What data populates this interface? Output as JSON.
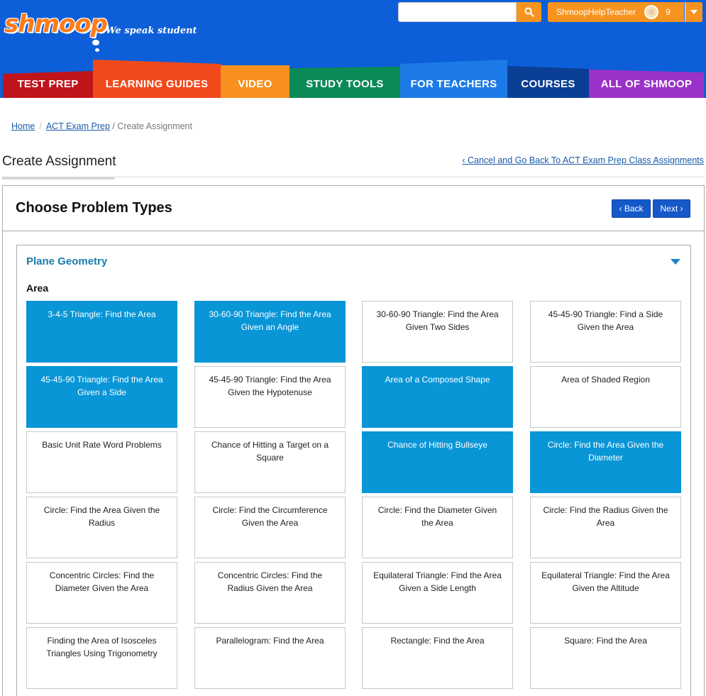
{
  "brand": {
    "logo_text": "shmoop",
    "tagline": "We speak student",
    "colors": {
      "header_bg": "#0c5fd8",
      "accent_orange": "#f79420",
      "selected_card": "#0896d7"
    }
  },
  "header": {
    "search": {
      "placeholder": "",
      "value": "",
      "icon": "search-icon"
    },
    "user": {
      "name": "ShmoopHelpTeacher",
      "points": "9",
      "avatar_icon": "coin-icon",
      "menu_icon": "caret-down-icon"
    }
  },
  "nav": {
    "tabs": [
      {
        "label": "TEST PREP",
        "color": "#c0141b"
      },
      {
        "label": "LEARNING GUIDES",
        "color": "#f0491c"
      },
      {
        "label": "VIDEO",
        "color": "#f7901e"
      },
      {
        "label": "STUDY TOOLS",
        "color": "#0a8a57"
      },
      {
        "label": "FOR TEACHERS",
        "color": "#1c7ae6"
      },
      {
        "label": "COURSES",
        "color": "#0b3f96"
      },
      {
        "label": "ALL OF SHMOOP",
        "color": "#9a31c8"
      }
    ]
  },
  "breadcrumb": {
    "home": "Home",
    "separator": "/",
    "parent": "ACT Exam Prep",
    "current": "/ Create Assignment"
  },
  "page": {
    "title": "Create Assignment",
    "cancel_link": "Cancel and Go Back To ACT Exam Prep Class Assignments",
    "cancel_icon": "chevron-left-icon"
  },
  "panel": {
    "title": "Choose Problem Types",
    "back_label": "‹ Back",
    "next_label": "Next ›"
  },
  "section": {
    "title": "Plane Geometry",
    "toggle_icon": "caret-down-icon",
    "subsection": "Area",
    "problems": [
      {
        "label": "3-4-5 Triangle: Find the Area",
        "selected": true
      },
      {
        "label": "30-60-90 Triangle: Find the Area Given an Angle",
        "selected": true
      },
      {
        "label": "30-60-90 Triangle: Find the Area Given Two Sides",
        "selected": false
      },
      {
        "label": "45-45-90 Triangle: Find a Side Given the Area",
        "selected": false
      },
      {
        "label": "45-45-90 Triangle: Find the Area Given a Side",
        "selected": true
      },
      {
        "label": "45-45-90 Triangle: Find the Area Given the Hypotenuse",
        "selected": false
      },
      {
        "label": "Area of a Composed Shape",
        "selected": true
      },
      {
        "label": "Area of Shaded Region",
        "selected": false
      },
      {
        "label": "Basic Unit Rate Word Problems",
        "selected": false
      },
      {
        "label": "Chance of Hitting a Target on a Square",
        "selected": false
      },
      {
        "label": "Chance of Hitting Bullseye",
        "selected": true
      },
      {
        "label": "Circle: Find the Area Given the Diameter",
        "selected": true
      },
      {
        "label": "Circle: Find the Area Given the Radius",
        "selected": false
      },
      {
        "label": "Circle: Find the Circumference Given the Area",
        "selected": false
      },
      {
        "label": "Circle: Find the Diameter Given the Area",
        "selected": false
      },
      {
        "label": "Circle: Find the Radius Given the Area",
        "selected": false
      },
      {
        "label": "Concentric Circles: Find the Diameter Given the Area",
        "selected": false
      },
      {
        "label": "Concentric Circles: Find the Radius Given the Area",
        "selected": false
      },
      {
        "label": "Equilateral Triangle: Find the Area Given a Side Length",
        "selected": false
      },
      {
        "label": "Equilateral Triangle: Find the Area Given the Altitude",
        "selected": false
      },
      {
        "label": "Finding the Area of Isosceles Triangles Using Trigonometry",
        "selected": false
      },
      {
        "label": "Parallelogram: Find the Area",
        "selected": false
      },
      {
        "label": "Rectangle: Find the Area",
        "selected": false
      },
      {
        "label": "Square: Find the Area",
        "selected": false
      }
    ]
  }
}
